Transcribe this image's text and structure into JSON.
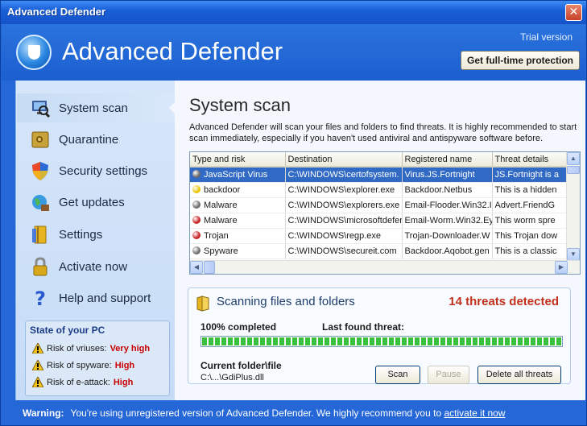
{
  "window": {
    "title": "Advanced Defender",
    "close_glyph": "✕"
  },
  "header": {
    "app_name": "Advanced Defender",
    "trial_label": "Trial version",
    "fulltime_button": "Get full-time protection"
  },
  "sidebar": {
    "items": [
      {
        "label": "System scan",
        "icon": "monitor-scan-icon"
      },
      {
        "label": "Quarantine",
        "icon": "safe-icon"
      },
      {
        "label": "Security settings",
        "icon": "shield-icon"
      },
      {
        "label": "Get updates",
        "icon": "globe-update-icon"
      },
      {
        "label": "Settings",
        "icon": "book-settings-icon"
      },
      {
        "label": "Activate now",
        "icon": "lock-icon"
      },
      {
        "label": "Help and support",
        "icon": "question-icon"
      }
    ],
    "state": {
      "title": "State of your PC",
      "risks": [
        {
          "label": "Risk of vriuses:",
          "value": "Very high"
        },
        {
          "label": "Risk of spyware:",
          "value": "High"
        },
        {
          "label": "Risk of e-attack:",
          "value": "High"
        }
      ]
    }
  },
  "main": {
    "title": "System scan",
    "description": "Advanced Defender will scan your files and folders to find threats. It is highly recommended to start scan immediately, especially if you haven't used antiviral and antispyware software before.",
    "table": {
      "columns": [
        "Type and risk",
        "Destination",
        "Registered name",
        "Threat details"
      ],
      "rows": [
        {
          "type": "JavaScript Virus",
          "risk_color": "#6a6a6a",
          "destination": "C:\\WINDOWS\\certofsystem.",
          "name": "Virus.JS.Fortnight",
          "details": "JS.Fortnight is a",
          "selected": true
        },
        {
          "type": "backdoor",
          "risk_color": "#e8c400",
          "destination": "C:\\WINDOWS\\explorer.exe",
          "name": "Backdoor.Netbus",
          "details": "This is a hidden"
        },
        {
          "type": "Malware",
          "risk_color": "#6a6a6a",
          "destination": "C:\\WINDOWS\\explorers.exe",
          "name": "Email-Flooder.Win32.I",
          "details": "Advert.FriendG"
        },
        {
          "type": "Malware",
          "risk_color": "#c81e1e",
          "destination": "C:\\WINDOWS\\microsoftdefer",
          "name": "Email-Worm.Win32.Ey",
          "details": "This worm spre"
        },
        {
          "type": "Trojan",
          "risk_color": "#c81e1e",
          "destination": "C:\\WINDOWS\\regp.exe",
          "name": "Trojan-Downloader.W",
          "details": "This Trojan dow"
        },
        {
          "type": "Spyware",
          "risk_color": "#6a6a6a",
          "destination": "C:\\WINDOWS\\secureit.com",
          "name": "Backdoor.Aqobot.gen",
          "details": "This is a classic"
        }
      ]
    },
    "scan": {
      "title": "Scanning files and folders",
      "threats_detected": "14 threats detected",
      "percent_label": "100% completed",
      "progress": 1.0,
      "last_found_label": "Last found threat:",
      "current_folder_label": "Current folder\\file",
      "current_path": "C:\\...\\GdiPlus.dll",
      "buttons": {
        "scan": "Scan",
        "pause": "Pause",
        "delete_all": "Delete all threats"
      }
    }
  },
  "footer": {
    "warning_label": "Warning:",
    "message": "You're using unregistered version of Advanced Defender. We highly recommend you to",
    "link": "activate it now"
  }
}
